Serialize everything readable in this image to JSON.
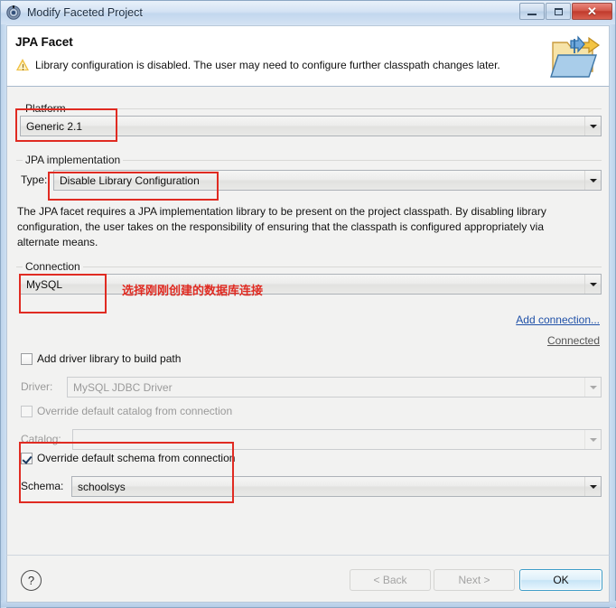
{
  "window": {
    "title": "Modify Faceted Project",
    "icon": "project-facets-icon",
    "controls": {
      "minimize": "minimize-icon",
      "maximize": "maximize-icon",
      "close": "close-icon"
    }
  },
  "header": {
    "title": "JPA Facet",
    "message": "Library configuration is disabled. The user may need to configure further classpath changes later.",
    "status_icon": "warning-icon",
    "banner_icon": "folder-import-export-icon"
  },
  "platform": {
    "group_label": "Platform",
    "value": "Generic 2.1"
  },
  "jpa_implementation": {
    "group_label": "JPA implementation",
    "type_label": "Type:",
    "type_value": "Disable Library Configuration",
    "description": "The JPA facet requires a JPA implementation library to be present on the project classpath. By disabling library configuration, the user takes on the responsibility of ensuring that the classpath is configured appropriately via alternate means."
  },
  "connection": {
    "group_label": "Connection",
    "value": "MySQL",
    "add_connection_link": "Add connection...",
    "status_link": "Connected",
    "add_driver_checkbox": {
      "label": "Add driver library to build path",
      "checked": false
    },
    "driver_label": "Driver:",
    "driver_value": "MySQL JDBC Driver",
    "override_catalog_checkbox": {
      "label": "Override default catalog from connection",
      "checked": false
    },
    "catalog_label": "Catalog:",
    "catalog_value": "",
    "override_schema_checkbox": {
      "label": "Override default schema from connection",
      "checked": true
    },
    "schema_label": "Schema:",
    "schema_value": "schoolsys"
  },
  "annotation": {
    "text": "选择刚刚创建的数据库连接",
    "color": "#e02b22"
  },
  "buttons": {
    "help": "?",
    "back": "< Back",
    "next": "Next >",
    "ok": "OK"
  },
  "colors": {
    "annotation_red": "#e02b22",
    "link_blue": "#2051a8",
    "primary_border": "#3c9cc8",
    "titlebar_start": "#e9f1fa",
    "content_bg": "#f2f2f1"
  }
}
